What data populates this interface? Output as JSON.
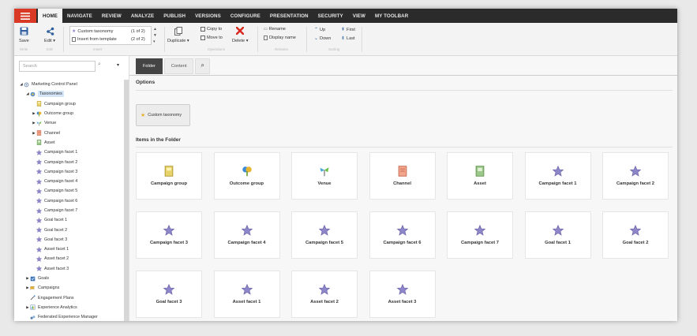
{
  "nav": {
    "tabs": [
      "HOME",
      "NAVIGATE",
      "REVIEW",
      "ANALYZE",
      "PUBLISH",
      "VERSIONS",
      "CONFIGURE",
      "PRESENTATION",
      "SECURITY",
      "VIEW",
      "MY TOOLBAR"
    ],
    "active": "HOME"
  },
  "ribbon": {
    "save": "Save",
    "edit": "Edit",
    "insert_item_1": "Custom taxonomy",
    "insert_item_1_count": "(1 of 2)",
    "insert_item_2": "Insert from template",
    "insert_item_2_count": "(2 of 2)",
    "duplicate": "Duplicate",
    "copy_to": "Copy to",
    "move_to": "Move to",
    "delete": "Delete",
    "rename": "Rename",
    "display_name": "Display name",
    "up": "Up",
    "down": "Down",
    "first": "First",
    "last": "Last"
  },
  "search": {
    "placeholder": "Search"
  },
  "tree": [
    {
      "label": "Marketing Control Panel",
      "level": 0,
      "arrow": "open",
      "icon": "control-panel"
    },
    {
      "label": "Taxonomies",
      "level": 1,
      "arrow": "open",
      "icon": "taxonomy",
      "selected": true
    },
    {
      "label": "Campaign group",
      "level": 2,
      "arrow": "none",
      "icon": "folder-yellow"
    },
    {
      "label": "Outcome group",
      "level": 2,
      "arrow": "closed",
      "icon": "outcome"
    },
    {
      "label": "Venue",
      "level": 2,
      "arrow": "closed",
      "icon": "venue"
    },
    {
      "label": "Channel",
      "level": 2,
      "arrow": "closed",
      "icon": "channel"
    },
    {
      "label": "Asset",
      "level": 2,
      "arrow": "none",
      "icon": "asset"
    },
    {
      "label": "Campaign facet 1",
      "level": 2,
      "arrow": "none",
      "icon": "star"
    },
    {
      "label": "Campaign facet 2",
      "level": 2,
      "arrow": "none",
      "icon": "star"
    },
    {
      "label": "Campaign facet 3",
      "level": 2,
      "arrow": "none",
      "icon": "star"
    },
    {
      "label": "Campaign facet 4",
      "level": 2,
      "arrow": "none",
      "icon": "star"
    },
    {
      "label": "Campaign facet 5",
      "level": 2,
      "arrow": "none",
      "icon": "star"
    },
    {
      "label": "Campaign facet 6",
      "level": 2,
      "arrow": "none",
      "icon": "star"
    },
    {
      "label": "Campaign facet 7",
      "level": 2,
      "arrow": "none",
      "icon": "star"
    },
    {
      "label": "Goal facet 1",
      "level": 2,
      "arrow": "none",
      "icon": "star"
    },
    {
      "label": "Goal facet 2",
      "level": 2,
      "arrow": "none",
      "icon": "star"
    },
    {
      "label": "Goal facet 3",
      "level": 2,
      "arrow": "none",
      "icon": "star"
    },
    {
      "label": "Asset facet 1",
      "level": 2,
      "arrow": "none",
      "icon": "star"
    },
    {
      "label": "Asset facet 2",
      "level": 2,
      "arrow": "none",
      "icon": "star"
    },
    {
      "label": "Asset facet 3",
      "level": 2,
      "arrow": "none",
      "icon": "star"
    },
    {
      "label": "Goals",
      "level": 1,
      "arrow": "closed",
      "icon": "goals"
    },
    {
      "label": "Campaigns",
      "level": 1,
      "arrow": "closed",
      "icon": "campaigns"
    },
    {
      "label": "Engagement Plans",
      "level": 1,
      "arrow": "none",
      "icon": "engagement"
    },
    {
      "label": "Experience Analytics",
      "level": 1,
      "arrow": "closed",
      "icon": "analytics"
    },
    {
      "label": "Federated Experience Manager",
      "level": 1,
      "arrow": "none",
      "icon": "federated"
    }
  ],
  "main": {
    "tabs": [
      "Folder",
      "Content"
    ],
    "active_tab": "Folder",
    "options_title": "Options",
    "option_button": "Custom taxonomy",
    "items_title": "Items in the Folder",
    "items": [
      {
        "label": "Campaign group",
        "icon": "folder-yellow"
      },
      {
        "label": "Outcome group",
        "icon": "outcome"
      },
      {
        "label": "Venue",
        "icon": "venue"
      },
      {
        "label": "Channel",
        "icon": "channel"
      },
      {
        "label": "Asset",
        "icon": "asset"
      },
      {
        "label": "Campaign facet 1",
        "icon": "star"
      },
      {
        "label": "Campaign facet 2",
        "icon": "star"
      },
      {
        "label": "Campaign facet 3",
        "icon": "star"
      },
      {
        "label": "Campaign facet 4",
        "icon": "star"
      },
      {
        "label": "Campaign facet 5",
        "icon": "star"
      },
      {
        "label": "Campaign facet 6",
        "icon": "star"
      },
      {
        "label": "Campaign facet 7",
        "icon": "star"
      },
      {
        "label": "Goal facet 1",
        "icon": "star"
      },
      {
        "label": "Goal facet 2",
        "icon": "star"
      },
      {
        "label": "Goal facet 3",
        "icon": "star"
      },
      {
        "label": "Asset facet 1",
        "icon": "star"
      },
      {
        "label": "Asset facet 2",
        "icon": "star"
      },
      {
        "label": "Asset facet 3",
        "icon": "star"
      }
    ]
  },
  "colors": {
    "menu_red": "#d93a26",
    "nav_dark": "#2b2b2b",
    "selected_bg": "#d4e6f7",
    "star_purple": "#8d86c9"
  }
}
